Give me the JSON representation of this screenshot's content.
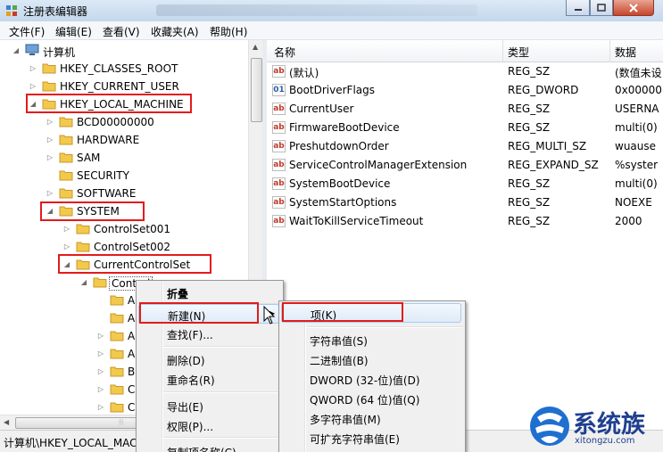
{
  "window": {
    "title": "注册表编辑器"
  },
  "menubar": [
    "文件(F)",
    "编辑(E)",
    "查看(V)",
    "收藏夹(A)",
    "帮助(H)"
  ],
  "tree": [
    {
      "label": "计算机",
      "expander": "◢",
      "icon": "computer"
    },
    {
      "label": "HKEY_CLASSES_ROOT",
      "expander": "▷"
    },
    {
      "label": "HKEY_CURRENT_USER",
      "expander": "▷"
    },
    {
      "label": "HKEY_LOCAL_MACHINE",
      "expander": "◢"
    },
    {
      "label": "BCD00000000",
      "expander": "▷"
    },
    {
      "label": "HARDWARE",
      "expander": "▷"
    },
    {
      "label": "SAM",
      "expander": "▷"
    },
    {
      "label": "SECURITY",
      "expander": ""
    },
    {
      "label": "SOFTWARE",
      "expander": "▷"
    },
    {
      "label": "SYSTEM",
      "expander": "◢"
    },
    {
      "label": "ControlSet001",
      "expander": "▷"
    },
    {
      "label": "ControlSet002",
      "expander": "▷"
    },
    {
      "label": "CurrentControlSet",
      "expander": "◢"
    },
    {
      "label": "Control",
      "expander": "◢"
    },
    {
      "label": "A",
      "expander": ""
    },
    {
      "label": "A",
      "expander": ""
    },
    {
      "label": "A",
      "expander": "▷"
    },
    {
      "label": "A",
      "expander": "▷"
    },
    {
      "label": "B",
      "expander": "▷"
    },
    {
      "label": "C",
      "expander": "▷"
    },
    {
      "label": "C",
      "expander": "▷"
    }
  ],
  "list": {
    "columns": [
      "名称",
      "类型",
      "数据"
    ],
    "rows": [
      {
        "name": "(默认)",
        "type": "REG_SZ",
        "data": "(数值未设",
        "icon": "string"
      },
      {
        "name": "BootDriverFlags",
        "type": "REG_DWORD",
        "data": "0x00000",
        "icon": "binary"
      },
      {
        "name": "CurrentUser",
        "type": "REG_SZ",
        "data": "USERNA",
        "icon": "string"
      },
      {
        "name": "FirmwareBootDevice",
        "type": "REG_SZ",
        "data": "multi(0)",
        "icon": "string"
      },
      {
        "name": "PreshutdownOrder",
        "type": "REG_MULTI_SZ",
        "data": "wuause",
        "icon": "string"
      },
      {
        "name": "ServiceControlManagerExtension",
        "type": "REG_EXPAND_SZ",
        "data": "%syster",
        "icon": "string"
      },
      {
        "name": "SystemBootDevice",
        "type": "REG_SZ",
        "data": "multi(0)",
        "icon": "string"
      },
      {
        "name": "SystemStartOptions",
        "type": "REG_SZ",
        "data": " NOEXE",
        "icon": "string"
      },
      {
        "name": "WaitToKillServiceTimeout",
        "type": "REG_SZ",
        "data": "2000",
        "icon": "string"
      }
    ]
  },
  "status": {
    "path": "计算机\\HKEY_LOCAL_MAC"
  },
  "context_menu": {
    "collapse": "折叠",
    "new": "新建(N)",
    "find": "查找(F)...",
    "delete": "删除(D)",
    "rename": "重命名(R)",
    "export": "导出(E)",
    "permissions": "权限(P)...",
    "copy_key_name": "复制项名称(C)"
  },
  "submenu": {
    "key": "项(K)",
    "string": "字符串值(S)",
    "binary": "二进制值(B)",
    "dword": "DWORD (32-位)值(D)",
    "qword": "QWORD (64 位)值(Q)",
    "multi_string": "多字符串值(M)",
    "expand_string": "可扩充字符串值(E)"
  },
  "watermark": {
    "brand": "系统族",
    "url": "xitongzu.com"
  },
  "colors": {
    "highlight_box": "#e41b1b",
    "folder": "#f2c94c",
    "title_bar": "#c4d7ec"
  }
}
